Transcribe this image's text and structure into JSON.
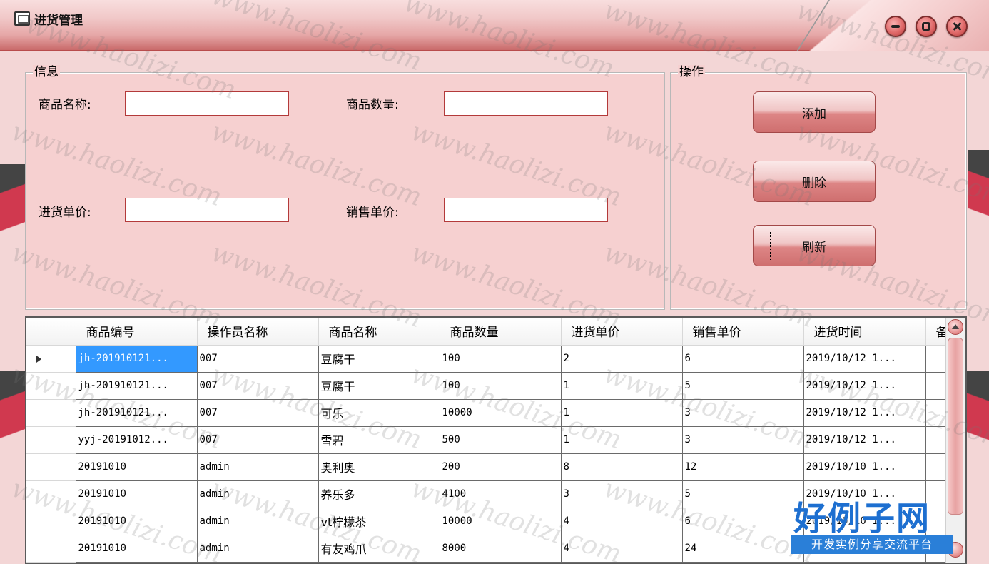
{
  "window": {
    "title": "进货管理",
    "icons": {
      "app": "monitor-icon",
      "minimize": "minimize-icon",
      "maximize": "maximize-icon",
      "close": "close-icon"
    },
    "accent_color": "#c96a6a"
  },
  "info_group": {
    "legend": "信息",
    "fields": [
      {
        "label": "商品名称:",
        "value": ""
      },
      {
        "label": "商品数量:",
        "value": ""
      },
      {
        "label": "进货单价:",
        "value": ""
      },
      {
        "label": "销售单价:",
        "value": ""
      }
    ]
  },
  "ops_group": {
    "legend": "操作",
    "buttons": [
      {
        "label": "添加"
      },
      {
        "label": "删除"
      },
      {
        "label": "刷新"
      }
    ]
  },
  "grid": {
    "columns": [
      "商品编号",
      "操作员名称",
      "商品名称",
      "商品数量",
      "进货单价",
      "销售单价",
      "进货时间",
      "备"
    ],
    "rows": [
      [
        "jh-201910121...",
        "007",
        "豆腐干",
        "100",
        "2",
        "6",
        "2019/10/12 1..."
      ],
      [
        "jh-201910121...",
        "007",
        "豆腐干",
        "100",
        "1",
        "5",
        "2019/10/12 1..."
      ],
      [
        "jh-201910121...",
        "007",
        "可乐",
        "10000",
        "1",
        "3",
        "2019/10/12 1..."
      ],
      [
        "yyj-20191012...",
        "007",
        "雪碧",
        "500",
        "1",
        "3",
        "2019/10/12 1..."
      ],
      [
        "20191010",
        "admin",
        "奥利奥",
        "200",
        "8",
        "12",
        "2019/10/10 1..."
      ],
      [
        "20191010",
        "admin",
        "养乐多",
        "4100",
        "3",
        "5",
        "2019/10/10 1..."
      ],
      [
        "20191010",
        "admin",
        "vt柠檬茶",
        "10000",
        "4",
        "6",
        "2019/10/10 1..."
      ],
      [
        "20191010",
        "admin",
        "有友鸡爪",
        "8000",
        "4",
        "24",
        "2019/10/10 1..."
      ]
    ],
    "selected_row": 0
  },
  "watermark": {
    "text": "www.haolizi.com",
    "badge_title": "好例子网",
    "badge_subtitle": "开发实例分享交流平台"
  }
}
